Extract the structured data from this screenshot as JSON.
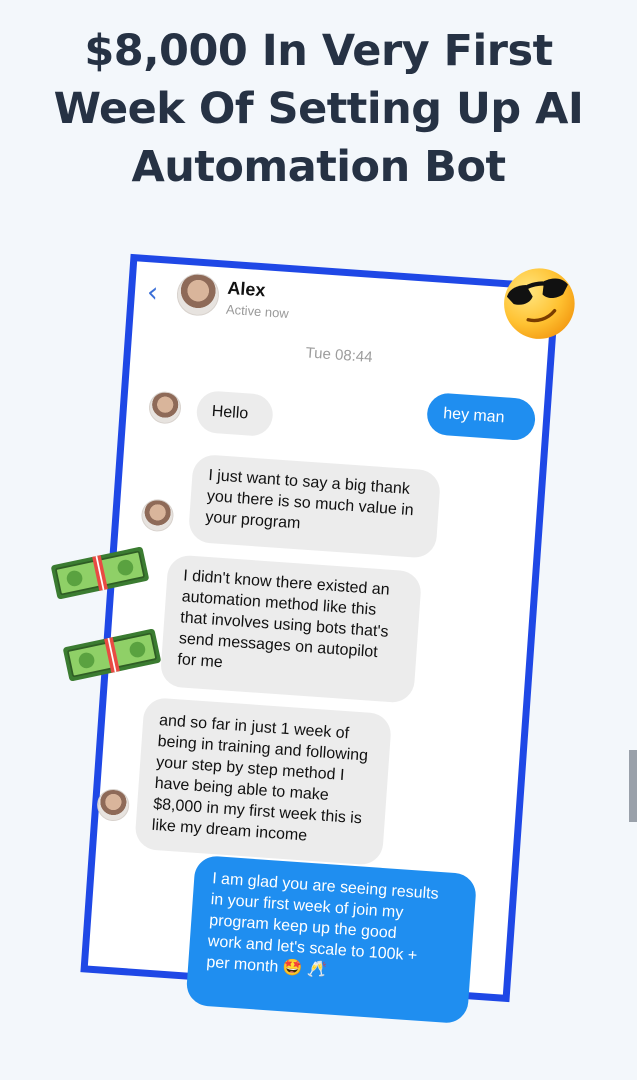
{
  "headline": {
    "line1": "$8,000 In Very First",
    "line2": "Week Of Setting Up AI",
    "line3": "Automation Bot"
  },
  "chat": {
    "contact_name": "Alex",
    "status": "Active now",
    "timestamp": "Tue 08:44",
    "messages": [
      {
        "side": "out",
        "text": "hey man"
      },
      {
        "side": "in",
        "text": "Hello"
      },
      {
        "side": "in",
        "text": "I just want to say a big thank\nyou there is so much value in\nyour program"
      },
      {
        "side": "in",
        "text": "I didn't know there existed an\nautomation method like this\nthat involves using bots that's\nsend messages on autopilot\nfor me"
      },
      {
        "side": "in",
        "text": "and so far in just 1 week of\nbeing in training and following\nyour step by step method I\nhave being able to make\n$8,000 in my first week this is\nlike my dream income"
      },
      {
        "side": "out",
        "text": "I am glad you are seeing results\nin your first week of join my\nprogram keep up the good\nwork and let's scale to 100k +\nper month 🤩 🥂"
      }
    ]
  },
  "colors": {
    "frame": "#1f48e6",
    "outgoing_bubble": "#1f8ef0",
    "incoming_bubble": "#ececec",
    "headline": "#263244"
  },
  "icons": {
    "back": "chevron-left-icon",
    "call": "phone-icon",
    "sticker_1": "sunglasses-emoji-icon",
    "sticker_2": "money-bill-icon"
  }
}
